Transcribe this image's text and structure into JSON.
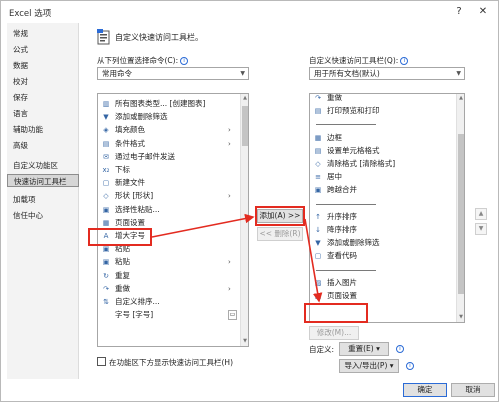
{
  "window": {
    "title": "Excel 选项",
    "help_label": "?",
    "close_label": "✕"
  },
  "nav": {
    "items": [
      {
        "label": "常规"
      },
      {
        "label": "公式"
      },
      {
        "label": "数据"
      },
      {
        "label": "校对"
      },
      {
        "label": "保存"
      },
      {
        "label": "语言"
      },
      {
        "label": "辅助功能"
      },
      {
        "label": "高级"
      },
      {
        "label": "自定义功能区"
      },
      {
        "label": "快速访问工具栏"
      },
      {
        "label": "加载项"
      },
      {
        "label": "信任中心"
      }
    ]
  },
  "header": {
    "title": "自定义快速访问工具栏。"
  },
  "left": {
    "choose_label": "从下列位置选择命令(C):",
    "choose_value": "常用命令",
    "commands": [
      {
        "icon": "bar-chart-icon",
        "glyph": "▥",
        "label": "所有图表类型... [创建图表]"
      },
      {
        "icon": "filter-icon",
        "glyph": "▼",
        "label": "添加或删除筛选"
      },
      {
        "icon": "fill-color-icon",
        "glyph": "◈",
        "label": "填充颜色",
        "submenu": true
      },
      {
        "icon": "conditional-format-icon",
        "glyph": "▤",
        "label": "条件格式",
        "submenu": true
      },
      {
        "icon": "email-icon",
        "glyph": "✉",
        "label": "通过电子邮件发送"
      },
      {
        "icon": "subscript-icon",
        "glyph": "x₂",
        "label": "下标"
      },
      {
        "icon": "new-file-icon",
        "glyph": "▢",
        "label": "新建文件"
      },
      {
        "icon": "shapes-icon",
        "glyph": "◇",
        "label": "形状 [形状]",
        "submenu": true
      },
      {
        "icon": "paste-special-icon",
        "glyph": "▣",
        "label": "选择性粘贴..."
      },
      {
        "icon": "page-setup-icon",
        "glyph": "▦",
        "label": "页面设置"
      },
      {
        "icon": "font-increase-icon",
        "glyph": "A",
        "label": "增大字号"
      },
      {
        "icon": "paste-icon",
        "glyph": "▣",
        "label": "粘贴"
      },
      {
        "icon": "paste-icon",
        "glyph": "▣",
        "label": "粘贴",
        "submenu": true
      },
      {
        "icon": "redo-icon",
        "glyph": "↻",
        "label": "重复"
      },
      {
        "icon": "redo-icon",
        "glyph": "↷",
        "label": "重做",
        "submenu": true
      },
      {
        "icon": "customize-sort-icon",
        "glyph": "⇅",
        "label": "自定义排序..."
      },
      {
        "icon": "font-icon",
        "glyph": "",
        "label": "字号 [字号]",
        "submenu_box": true
      }
    ],
    "show_below_label": "在功能区下方显示快速访问工具栏(H)"
  },
  "center": {
    "add_label": "添加(A) >>",
    "remove_label": "<< 删除(R)"
  },
  "right": {
    "customize_label": "自定义快速访问工具栏(Q):",
    "customize_value": "用于所有文档(默认)",
    "toolbar_items": [
      {
        "icon": "redo-icon",
        "glyph": "↷",
        "label": "重做"
      },
      {
        "icon": "print-preview-icon",
        "glyph": "▤",
        "label": "打印预览和打印"
      },
      {
        "icon": "separator",
        "glyph": "",
        "label": ""
      },
      {
        "icon": "border-icon",
        "glyph": "▦",
        "label": "边框"
      },
      {
        "icon": "format-cells-icon",
        "glyph": "▤",
        "label": "设置单元格格式"
      },
      {
        "icon": "clear-format-icon",
        "glyph": "◇",
        "label": "清除格式 [清除格式]"
      },
      {
        "icon": "center-icon",
        "glyph": "≡",
        "label": "居中"
      },
      {
        "icon": "merge-icon",
        "glyph": "▣",
        "label": "跨越合并"
      },
      {
        "icon": "separator",
        "glyph": "",
        "label": ""
      },
      {
        "icon": "sort-asc-icon",
        "glyph": "↑",
        "label": "升序排序"
      },
      {
        "icon": "sort-desc-icon",
        "glyph": "↓",
        "label": "降序排序"
      },
      {
        "icon": "filter-icon",
        "glyph": "▼",
        "label": "添加或删除筛选"
      },
      {
        "icon": "view-code-icon",
        "glyph": "▢",
        "label": "查看代码"
      },
      {
        "icon": "separator",
        "glyph": "",
        "label": ""
      },
      {
        "icon": "insert-picture-icon",
        "glyph": "▨",
        "label": "插入图片"
      },
      {
        "icon": "page-setup-icon",
        "glyph": "▦",
        "label": "页面设置"
      }
    ],
    "modify_label": "修改(M)...",
    "customize_short_label": "自定义:",
    "reset_label": "重置(E) ▾",
    "import_export_label": "导入/导出(P) ▾"
  },
  "footer": {
    "ok_label": "确定",
    "cancel_label": "取消"
  },
  "colors": {
    "highlight": "#e32b20",
    "accent": "#2b6bd6"
  }
}
